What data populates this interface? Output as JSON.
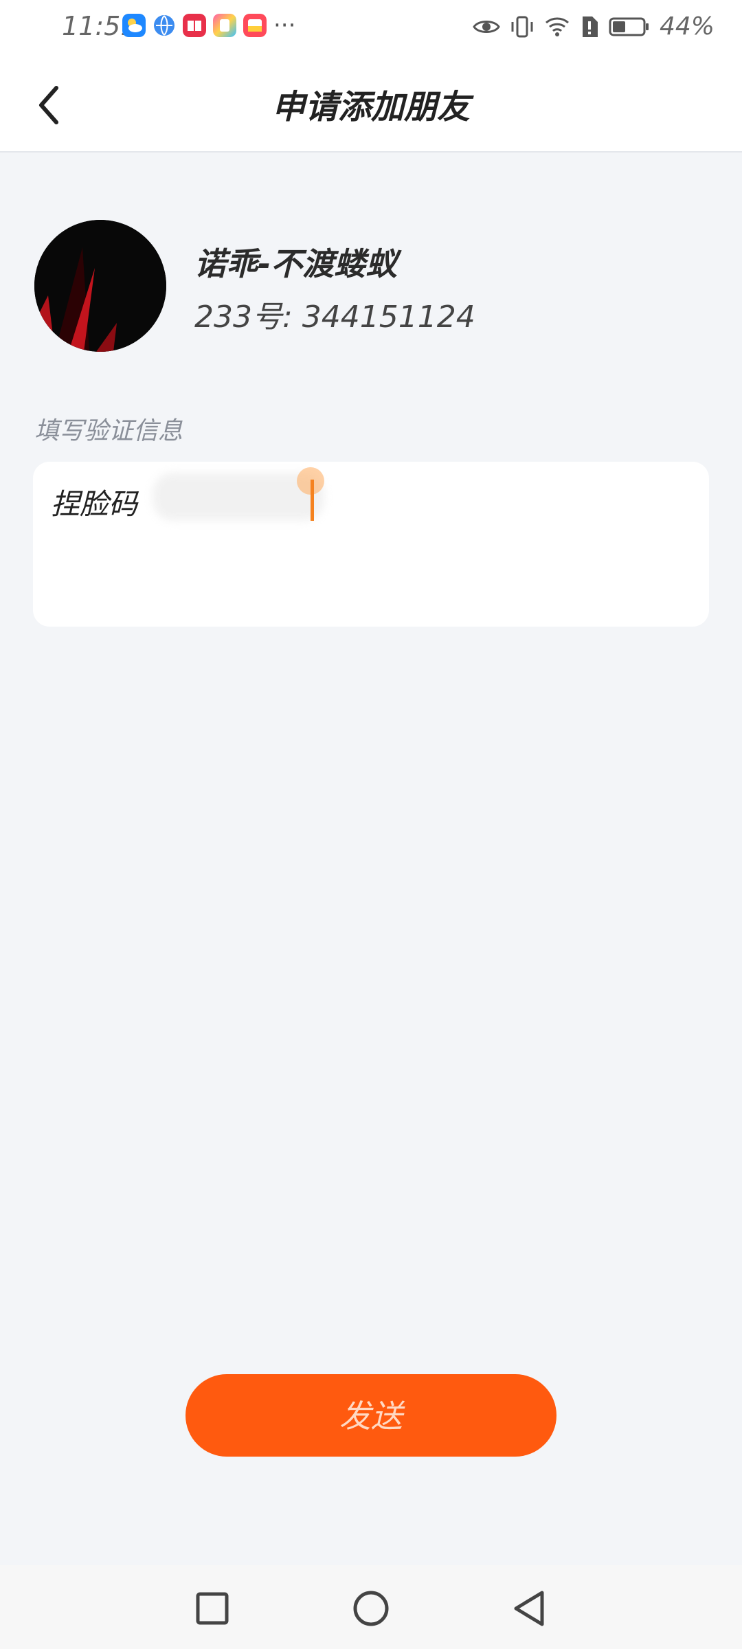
{
  "status_bar": {
    "time": "11:51",
    "battery_percent": "44%",
    "battery_level": 0.44,
    "more_indicator": "···",
    "app_icons": [
      "weather-icon",
      "browser-icon",
      "book-icon",
      "assistant-icon",
      "notes-icon"
    ]
  },
  "header": {
    "title": "申请添加朋友"
  },
  "profile": {
    "name": "诺乖-不渡蝼蚁",
    "id_line": "233号: 344151124"
  },
  "verification": {
    "label": "填写验证信息",
    "value": "捏脸码"
  },
  "actions": {
    "send_label": "发送"
  },
  "colors": {
    "accent": "#ff5a0f",
    "background": "#f3f5f8"
  }
}
